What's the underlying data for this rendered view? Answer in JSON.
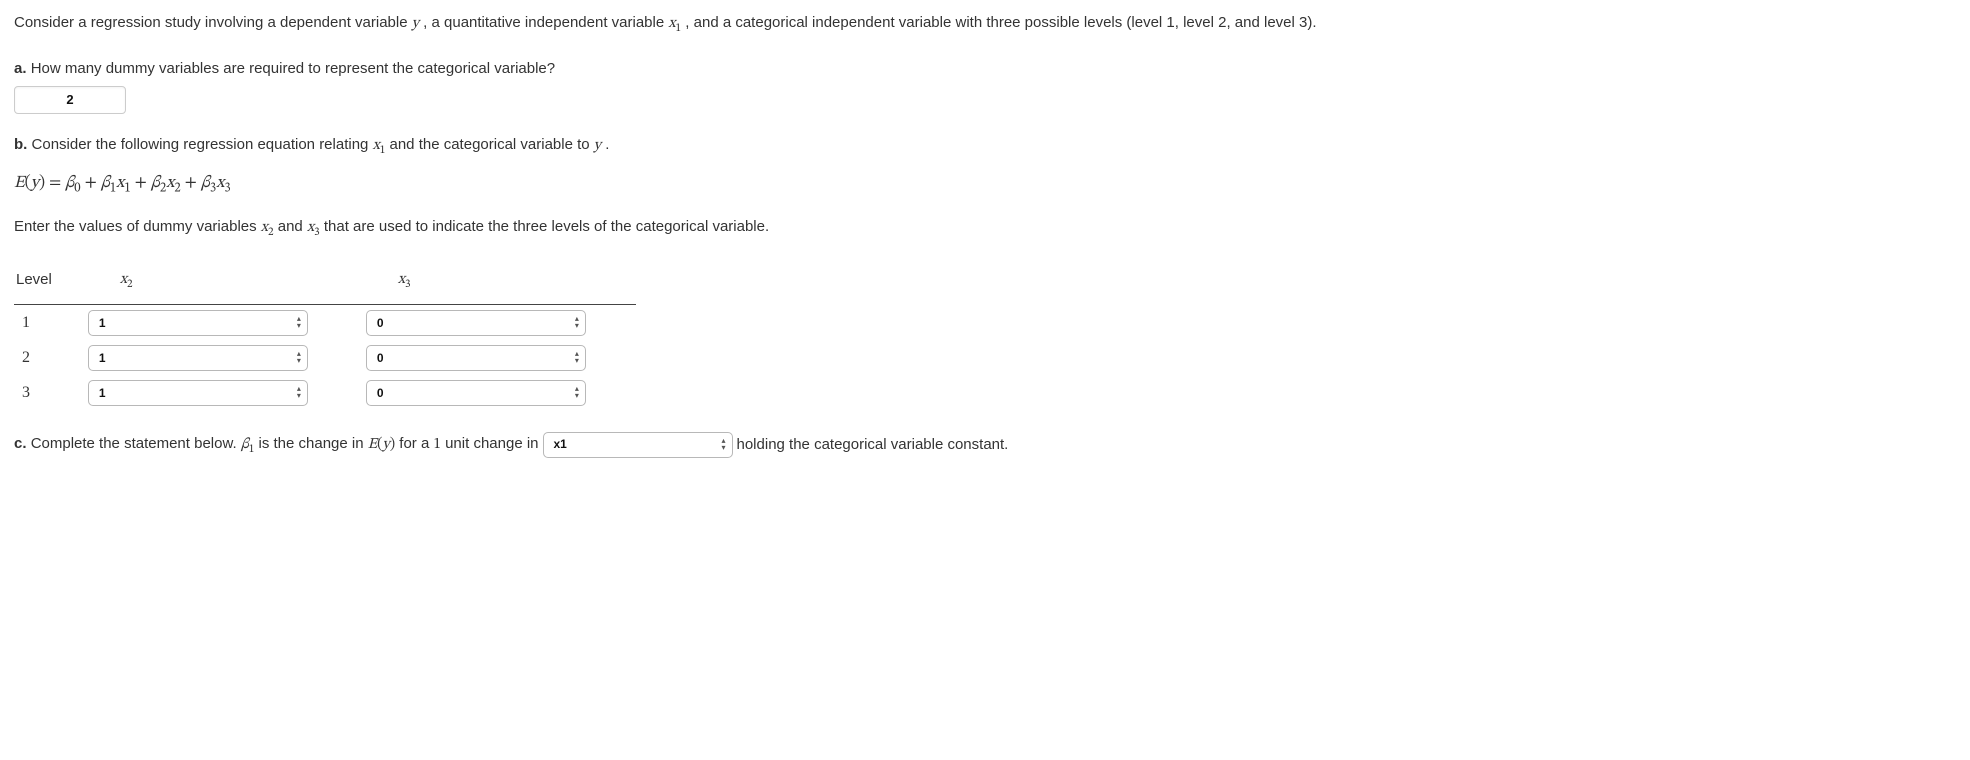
{
  "intro": {
    "text_before_y": "Consider a regression study involving a dependent variable ",
    "y": "y",
    "text_mid": ", a quantitative independent variable ",
    "x1": "x",
    "x1_sub": "1",
    "text_after": ", and a categorical independent variable with three possible levels (level 1, level 2, and level 3)."
  },
  "part_a": {
    "label": "a.",
    "question": " How many dummy variables are required to represent the categorical variable?",
    "answer": "2"
  },
  "part_b": {
    "label": "b.",
    "question_before": " Consider the following regression equation relating ",
    "x1": "x",
    "x1_sub": "1",
    "question_mid": " and the categorical variable to ",
    "y": "y",
    "question_end": ".",
    "equation": {
      "lhs_E": "E",
      "lhs_open": "(",
      "lhs_y": "y",
      "lhs_close": ") = ",
      "b0": "β",
      "b0_sub": "0",
      "plus1": " + ",
      "b1": "β",
      "b1_sub": "1",
      "x1": "x",
      "x1s": "1",
      "plus2": " + ",
      "b2": "β",
      "b2_sub": "2",
      "x2": "x",
      "x2s": "2",
      "plus3": " + ",
      "b3": "β",
      "b3_sub": "3",
      "x3": "x",
      "x3s": "3"
    },
    "instruction_before": "Enter the values of dummy variables ",
    "iv_x2": "x",
    "iv_x2_sub": "2",
    "instruction_and": " and ",
    "iv_x3": "x",
    "iv_x3_sub": "3",
    "instruction_after": " that are used to indicate the three levels of the categorical variable.",
    "headers": {
      "level": "Level",
      "x2": "x",
      "x2_sub": "2",
      "x3": "x",
      "x3_sub": "3"
    },
    "rows": [
      {
        "level": "1",
        "x2": "1",
        "x3": "0"
      },
      {
        "level": "2",
        "x2": "1",
        "x3": "0"
      },
      {
        "level": "3",
        "x2": "1",
        "x3": "0"
      }
    ]
  },
  "part_c": {
    "label": "c.",
    "text_before_b1": " Complete the statement below. ",
    "b1": "β",
    "b1_sub": "1",
    "text_mid1": " is the change in ",
    "E": "E",
    "open": "(",
    "y": "y",
    "close": ")",
    "text_mid2": " for a ",
    "one": "1",
    "text_mid3": " unit change in ",
    "select_value": "x1",
    "text_after": " holding the categorical variable constant."
  }
}
